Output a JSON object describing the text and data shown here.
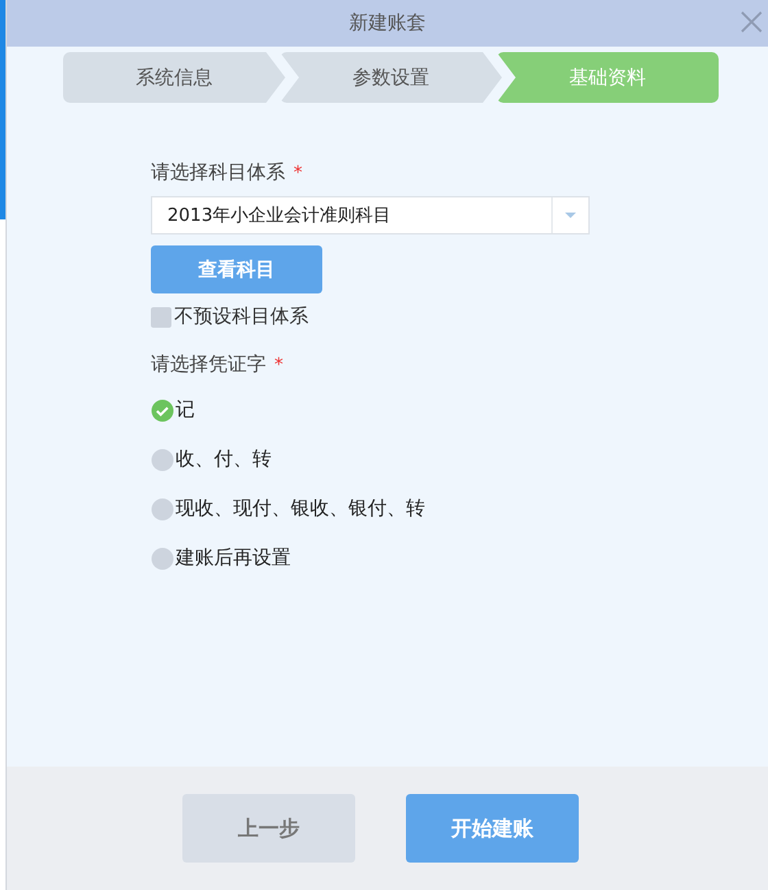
{
  "window": {
    "title": "新建账套"
  },
  "steps": [
    {
      "label": "系统信息",
      "selected": false
    },
    {
      "label": "参数设置",
      "selected": false
    },
    {
      "label": "基础资料",
      "selected": true
    }
  ],
  "account_system": {
    "label": "请选择科目体系",
    "required": "*",
    "value": "2013年小企业会计准则科目",
    "view_button": "查看科目",
    "no_preset": {
      "label": "不预设科目体系",
      "checked": false
    }
  },
  "voucher": {
    "label": "请选择凭证字",
    "required": "*",
    "options": [
      {
        "label": "记",
        "selected": true
      },
      {
        "label": "收、付、转",
        "selected": false
      },
      {
        "label": "现收、现付、银收、银付、转",
        "selected": false
      },
      {
        "label": "建账后再设置",
        "selected": false
      }
    ]
  },
  "buttons": [
    {
      "label": "上一步",
      "disabled": true
    },
    {
      "label": "开始建账",
      "disabled": false
    }
  ]
}
